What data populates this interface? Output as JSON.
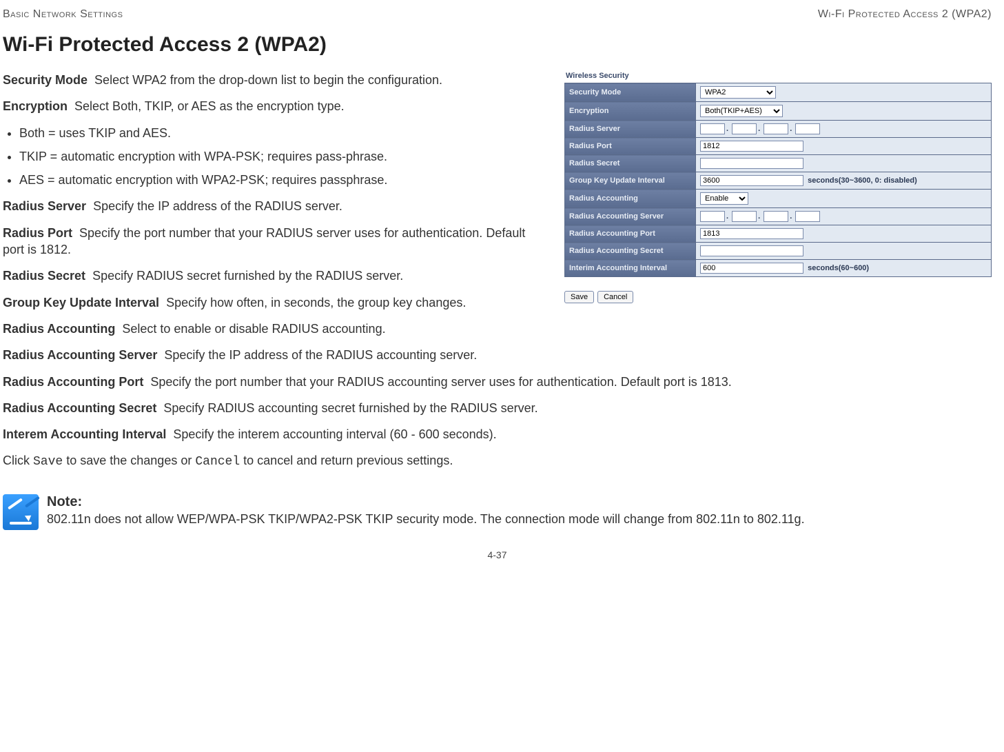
{
  "header": {
    "left": "Basic Network Settings",
    "right": "Wi-Fi Protected Access 2 (WPA2)"
  },
  "title": "Wi-Fi Protected Access 2 (WPA2)",
  "defs": {
    "security_mode": {
      "label": "Security Mode",
      "text": "Select WPA2 from the drop-down list to begin the configuration."
    },
    "encryption": {
      "label": "Encryption",
      "text": "Select Both, TKIP, or AES as the encryption type."
    },
    "enc_items": [
      "Both = uses TKIP and AES.",
      "TKIP = automatic encryption with WPA-PSK; requires pass-phrase.",
      "AES = automatic encryption with WPA2-PSK; requires passphrase."
    ],
    "radius_server": {
      "label": "Radius Server",
      "text": "Specify the IP address of the RADIUS server."
    },
    "radius_port": {
      "label": "Radius Port",
      "text": "Specify the port number that your RADIUS server uses for authentication. Default port is 1812."
    },
    "radius_secret": {
      "label": "Radius Secret",
      "text": "Specify RADIUS secret furnished by the RADIUS server."
    },
    "gku": {
      "label": "Group Key Update Interval",
      "text": "Specify how often, in seconds, the group key changes."
    },
    "racct": {
      "label": "Radius Accounting",
      "text": "Select to enable or disable RADIUS accounting."
    },
    "racct_srv": {
      "label": "Radius Accounting Server",
      "text": "Specify the IP address of the RADIUS accounting server."
    },
    "racct_port": {
      "label": "Radius Accounting Port",
      "text": "Specify the port number that your RADIUS accounting server uses for authentication. Default port is 1813."
    },
    "racct_secret": {
      "label": "Radius Accounting Secret",
      "text": "Specify RADIUS accounting secret furnished by the RADIUS server."
    },
    "interem": {
      "label": "Interem Accounting Interval",
      "text": "Specify the interem accounting interval (60 - 600 seconds)."
    },
    "closing_pre": "Click ",
    "closing_save": "Save",
    "closing_mid": " to save the changes or ",
    "closing_cancel": "Cancel",
    "closing_post": " to cancel and return previous settings."
  },
  "panel": {
    "title": "Wireless Security",
    "rows": {
      "security_mode": {
        "label": "Security Mode",
        "value": "WPA2"
      },
      "encryption": {
        "label": "Encryption",
        "value": "Both(TKIP+AES)"
      },
      "radius_server": {
        "label": "Radius Server"
      },
      "radius_port": {
        "label": "Radius Port",
        "value": "1812"
      },
      "radius_secret": {
        "label": "Radius Secret"
      },
      "gku": {
        "label": "Group Key Update Interval",
        "value": "3600",
        "hint": "seconds(30~3600, 0: disabled)"
      },
      "racct": {
        "label": "Radius Accounting",
        "value": "Enable"
      },
      "racct_srv": {
        "label": "Radius Accounting Server"
      },
      "racct_port": {
        "label": "Radius Accounting Port",
        "value": "1813"
      },
      "racct_secret": {
        "label": "Radius Accounting Secret"
      },
      "interem": {
        "label": "Interim Accounting Interval",
        "value": "600",
        "hint": "seconds(60~600)"
      }
    },
    "buttons": {
      "save": "Save",
      "cancel": "Cancel"
    }
  },
  "note": {
    "head": "Note:",
    "body": "802.11n does not allow WEP/WPA-PSK TKIP/WPA2-PSK TKIP security mode. The connection mode will change from 802.11n to 802.11g."
  },
  "pagenum": "4-37"
}
